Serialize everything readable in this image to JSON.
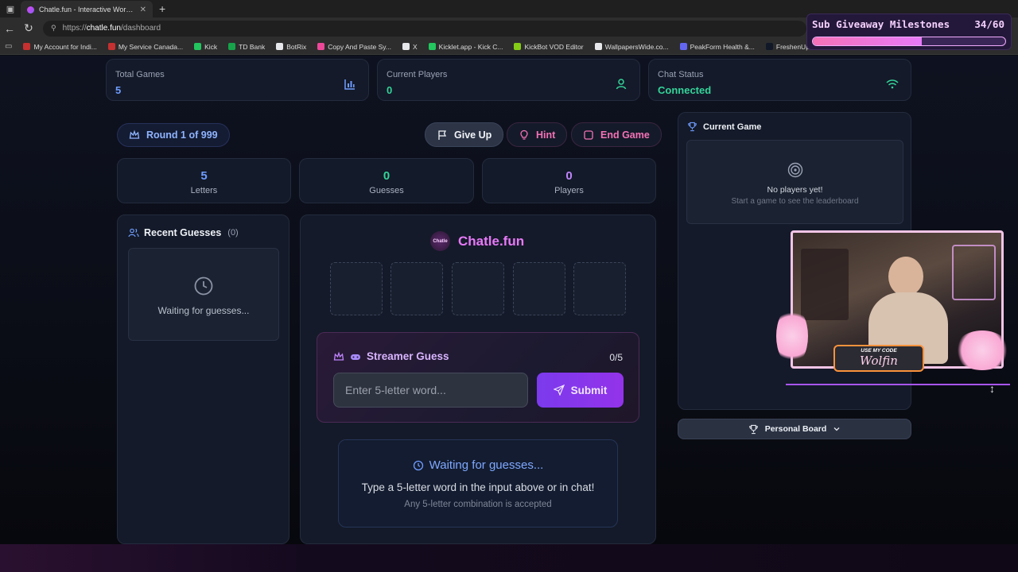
{
  "browser": {
    "tab_title": "Chatle.fun - Interactive Wordle Game",
    "url_prefix": "https://",
    "url_host": "chatle.fun",
    "url_path": "/dashboard",
    "bookmarks": [
      {
        "label": "My Account for Indi...",
        "color": "#c53030"
      },
      {
        "label": "My Service Canada...",
        "color": "#c53030"
      },
      {
        "label": "Kick",
        "color": "#22c55e"
      },
      {
        "label": "TD Bank",
        "color": "#16a34a"
      },
      {
        "label": "BotRix",
        "color": "#e5e7eb"
      },
      {
        "label": "Copy And Paste Sy...",
        "color": "#ec4899"
      },
      {
        "label": "X",
        "color": "#e5e7eb"
      },
      {
        "label": "Kicklet.app - Kick C...",
        "color": "#22c55e"
      },
      {
        "label": "KickBot VOD Editor",
        "color": "#84cc16"
      },
      {
        "label": "WallpapersWide.co...",
        "color": "#e5e7eb"
      },
      {
        "label": "PeakForm Health &...",
        "color": "#6366f1"
      },
      {
        "label": "FreshenUpPortal",
        "color": "#111827"
      }
    ]
  },
  "stats": {
    "total_games": {
      "title": "Total Games",
      "value": "5",
      "color": "#6f9cff"
    },
    "current_players": {
      "title": "Current Players",
      "value": "0",
      "color": "#34d399"
    },
    "chat_status": {
      "title": "Chat Status",
      "value": "Connected",
      "color": "#34d399"
    }
  },
  "game": {
    "round_label": "Round 1 of 999",
    "give_up": "Give Up",
    "hint": "Hint",
    "end_game": "End Game",
    "letters": {
      "value": "5",
      "label": "Letters"
    },
    "guesses": {
      "value": "0",
      "label": "Guesses"
    },
    "players": {
      "value": "0",
      "label": "Players"
    },
    "logo_badge": "Chatle",
    "brand": "Chatle.fun",
    "tiles": 5
  },
  "recent": {
    "title": "Recent Guesses",
    "count": "(0)",
    "empty": "Waiting for guesses..."
  },
  "streamer": {
    "title": "Streamer Guess",
    "counter": "0/5",
    "placeholder": "Enter 5-letter word...",
    "submit": "Submit"
  },
  "waiting": {
    "title": "Waiting for guesses...",
    "line1": "Type a 5-letter word in the input above or in chat!",
    "line2": "Any 5-letter combination is accepted"
  },
  "leaderboard": {
    "title": "Current Game",
    "empty_title": "No players yet!",
    "empty_sub": "Start a game to see the leaderboard",
    "personal_board": "Personal Board"
  },
  "overlay": {
    "milestone_title": "Sub Giveaway Milestones",
    "milestone_count": "34/60",
    "milestone_progress": 0.567,
    "code_label": "USE MY CODE",
    "code_value": "Wolfin"
  },
  "colors": {
    "accent_pink": "#f472b6",
    "accent_purple": "#7c3aed",
    "accent_blue": "#6f9cff",
    "success": "#34d399"
  }
}
